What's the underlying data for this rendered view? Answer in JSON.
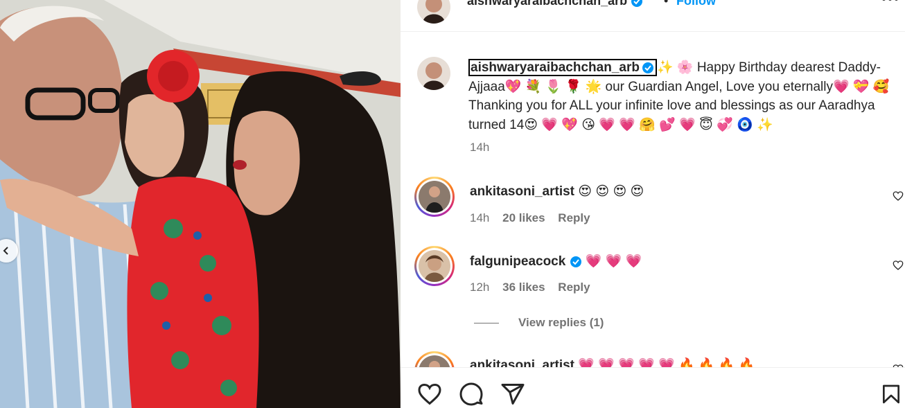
{
  "post": {
    "username": "aishwaryaraibachchan_arb",
    "follow_label": "Follow",
    "separator": "•",
    "more_label": "•••",
    "caption": {
      "username": "aishwaryaraibachchan_arb",
      "text": "✨ 🌸 Happy Birthday dearest Daddy-Ajjaaa💖 💐 🌷 🌹 🌟 our Guardian Angel, Love you eternally💗 💝 🥰Thanking you for ALL your infinite love and blessings as our Aaradhya turned 14😍 💗 💖 😘 💗 💗 🤗 💕 💗 😇 💞 🧿 ✨",
      "time": "14h"
    }
  },
  "comments": [
    {
      "username": "ankitasoni_artist",
      "verified": false,
      "text": "😍 😍 😍 😍",
      "time": "14h",
      "likes": "20 likes",
      "reply": "Reply"
    },
    {
      "username": "falgunipeacock",
      "verified": true,
      "text": "💗 💗 💗",
      "time": "12h",
      "likes": "36 likes",
      "reply": "Reply",
      "view_replies": "View replies (1)"
    },
    {
      "username": "ankitasoni_artist",
      "verified": false,
      "text": "💗 💗 💗 💗 💗 🔥 🔥 🔥 🔥",
      "time": "",
      "likes": "",
      "reply": ""
    }
  ],
  "icons": {
    "verified": "verified-badge-icon",
    "like": "heart-icon",
    "comment": "comment-icon",
    "share": "paper-plane-icon",
    "save": "bookmark-icon",
    "comment_like": "heart-outline-icon",
    "carousel_prev": "chevron-left-icon"
  },
  "colors": {
    "verified_blue": "#0095f6",
    "link_blue": "#0095f6",
    "muted": "#737373",
    "text": "#262626"
  }
}
